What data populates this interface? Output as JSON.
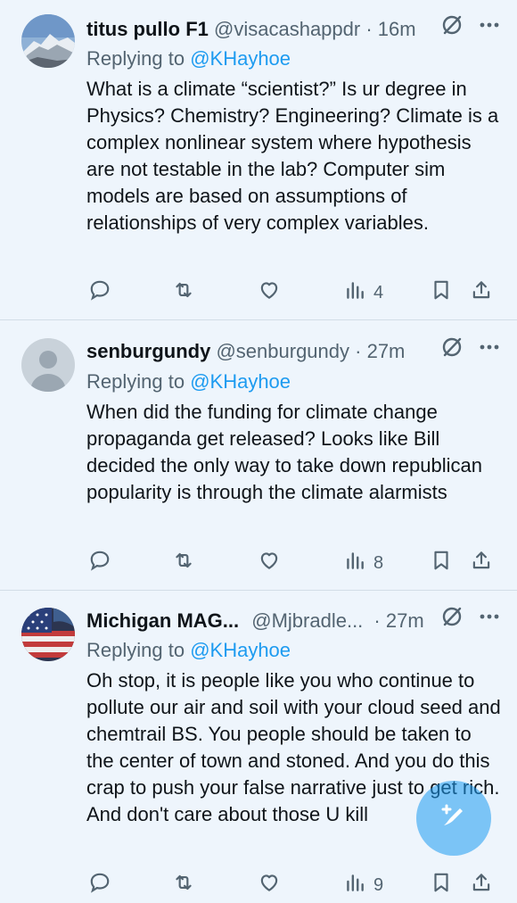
{
  "tweets": [
    {
      "name": "titus pullo F1",
      "handle": "@visacashappdr",
      "time": "· 16m",
      "replying_prefix": "Replying to ",
      "replying_to": "@KHayhoe",
      "text": "What is a climate “scientist?”  Is ur degree in Physics?  Chemistry?  Engineering?  Climate is a complex nonlinear system where hypothesis are not testable in the lab? Computer sim models are based on assumptions of relationships of very complex variables.",
      "views": "4"
    },
    {
      "name": "senburgundy",
      "handle": "@senburgundy",
      "time": "· 27m",
      "replying_prefix": "Replying to ",
      "replying_to": "@KHayhoe",
      "text": "When did the funding for climate change propaganda get released?  Looks like Bill decided the only way to take down republican popularity is through the climate alarmists",
      "views": "8"
    },
    {
      "name": "Michigan MAG...",
      "handle": "@Mjbradle...",
      "time": "· 27m",
      "replying_prefix": "Replying to ",
      "replying_to": "@KHayhoe",
      "text": "Oh stop, it is people like you who continue to pollute our air and soil with your cloud seed and chemtrail BS. You people  should be taken to the center of town and stoned. And you do this crap to push your false narrative just to get rich. And don't care about those U kill",
      "views": "9"
    }
  ],
  "colors": {
    "background": "#eef5fc",
    "text": "#0f1419",
    "secondary": "#536471",
    "accent": "#1d9bf0"
  },
  "icons": {
    "reply": "speech-bubble-icon",
    "retweet": "repost-icon",
    "like": "heart-icon",
    "views": "bar-chart-icon",
    "bookmark": "bookmark-icon",
    "share": "share-icon",
    "grok": "grok-slash-icon",
    "more": "more-dots-icon",
    "compose": "compose-icon"
  }
}
